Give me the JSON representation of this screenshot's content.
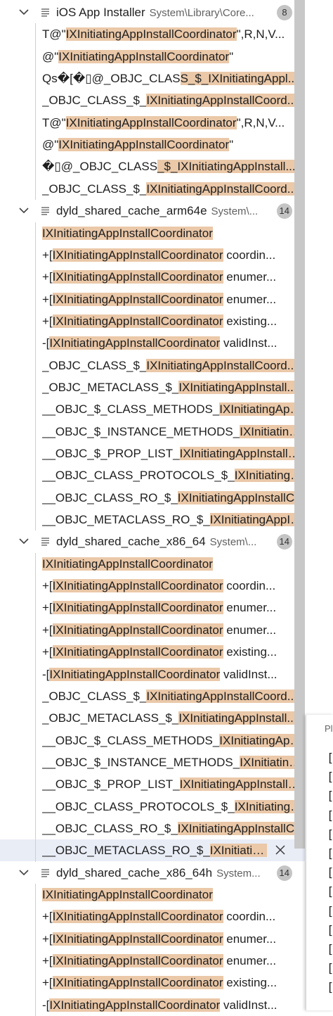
{
  "groups": [
    {
      "name": "iOS App Installer",
      "path": "System\\Library\\Core...",
      "count": "8",
      "matches": [
        [
          "T@\"",
          "IXInitiatingAppInstallCoordinator",
          "\",R,N,V..."
        ],
        [
          "@\"",
          "IXInitiatingAppInstallCoordinator",
          "\""
        ],
        [
          "Qs�[�▯@_OBJC_CLAS",
          "S_$_IXInitiatingAppl...",
          ""
        ],
        [
          "_OBJC_CLASS_$_",
          "IXInitiatingAppInstallCoord...",
          ""
        ],
        [
          "T@\"",
          "IXInitiatingAppInstallCoordinator",
          "\",R,N,V..."
        ],
        [
          "@\"",
          "IXInitiatingAppInstallCoordinator",
          "\""
        ],
        [
          "�▯@_OBJC_CLASS",
          "_$_IXInitiatingAppInstall...",
          ""
        ],
        [
          "_OBJC_CLASS_$_",
          "IXInitiatingAppInstallCoord...",
          ""
        ]
      ]
    },
    {
      "name": "dyld_shared_cache_arm64e",
      "path": "System\\...",
      "count": "14",
      "matches": [
        [
          "",
          "IXInitiatingAppInstallCoordinator",
          ""
        ],
        [
          "+[",
          "IXInitiatingAppInstallCoordinator",
          " coordin..."
        ],
        [
          "+[",
          "IXInitiatingAppInstallCoordinator",
          " enumer..."
        ],
        [
          "+[",
          "IXInitiatingAppInstallCoordinator",
          " enumer..."
        ],
        [
          "+[",
          "IXInitiatingAppInstallCoordinator",
          " existing..."
        ],
        [
          "-[",
          "IXInitiatingAppInstallCoordinator",
          " validInst..."
        ],
        [
          "_OBJC_CLASS_$_",
          "IXInitiatingAppInstallCoord...",
          ""
        ],
        [
          "_OBJC_METACLASS_$_",
          "IXInitiatingAppInstall...",
          ""
        ],
        [
          "__OBJC_$_CLASS_METHODS_",
          "IXInitiatingApp...",
          ""
        ],
        [
          "__OBJC_$_INSTANCE_METHODS_",
          "IXInitiating...",
          ""
        ],
        [
          "__OBJC_$_PROP_LIST_",
          "IXInitiatingAppInstallC...",
          ""
        ],
        [
          "__OBJC_CLASS_PROTOCOLS_$_",
          "IXInitiatingA...",
          ""
        ],
        [
          "__OBJC_CLASS_RO_$_",
          "IXInitiatingAppInstallC...",
          ""
        ],
        [
          "__OBJC_METACLASS_RO_$_",
          "IXInitiatingAppIn...",
          ""
        ]
      ]
    },
    {
      "name": "dyld_shared_cache_x86_64",
      "path": "System\\...",
      "count": "14",
      "matches": [
        [
          "",
          "IXInitiatingAppInstallCoordinator",
          ""
        ],
        [
          "+[",
          "IXInitiatingAppInstallCoordinator",
          " coordin..."
        ],
        [
          "+[",
          "IXInitiatingAppInstallCoordinator",
          " enumer..."
        ],
        [
          "+[",
          "IXInitiatingAppInstallCoordinator",
          " enumer..."
        ],
        [
          "+[",
          "IXInitiatingAppInstallCoordinator",
          " existing..."
        ],
        [
          "-[",
          "IXInitiatingAppInstallCoordinator",
          " validInst..."
        ],
        [
          "_OBJC_CLASS_$_",
          "IXInitiatingAppInstallCoord...",
          ""
        ],
        [
          "_OBJC_METACLASS_$_",
          "IXInitiatingAppInstall...",
          ""
        ],
        [
          "__OBJC_$_CLASS_METHODS_",
          "IXInitiatingApp...",
          ""
        ],
        [
          "__OBJC_$_INSTANCE_METHODS_",
          "IXInitiating...",
          ""
        ],
        [
          "__OBJC_$_PROP_LIST_",
          "IXInitiatingAppInstallC...",
          ""
        ],
        [
          "__OBJC_CLASS_PROTOCOLS_$_",
          "IXInitiatingA...",
          ""
        ],
        [
          "__OBJC_CLASS_RO_$_",
          "IXInitiatingAppInstallC...",
          ""
        ],
        [
          "__OBJC_METACLASS_RO_$_",
          "IXInitiatin...",
          ""
        ]
      ]
    },
    {
      "name": "dyld_shared_cache_x86_64h",
      "path": "System...",
      "count": "14",
      "matches": [
        [
          "",
          "IXInitiatingAppInstallCoordinator",
          ""
        ],
        [
          "+[",
          "IXInitiatingAppInstallCoordinator",
          " coordin..."
        ],
        [
          "+[",
          "IXInitiatingAppInstallCoordinator",
          " enumer..."
        ],
        [
          "+[",
          "IXInitiatingAppInstallCoordinator",
          " enumer..."
        ],
        [
          "+[",
          "IXInitiatingAppInstallCoordinator",
          " existing..."
        ],
        [
          "-[",
          "IXInitiatingAppInstallCoordinator",
          " validInst..."
        ]
      ]
    }
  ],
  "selected": {
    "group": 2,
    "match": 13
  },
  "overlay": {
    "label": "Pl",
    "glyph": "["
  },
  "colors": {
    "highlight": "#eac8a8",
    "selected_row": "#e9edf6",
    "badge": "#c4c4c4"
  }
}
